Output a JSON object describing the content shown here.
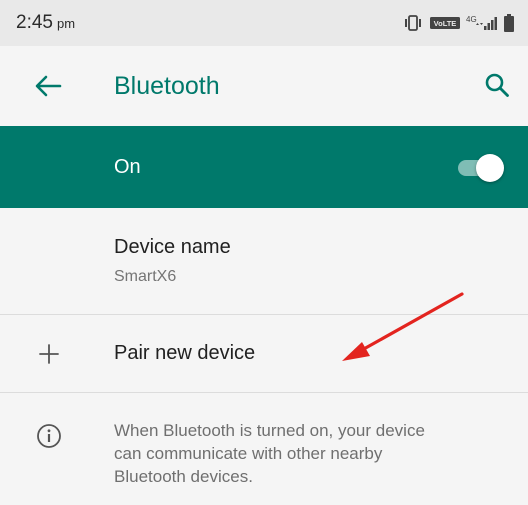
{
  "status_bar": {
    "time": "2:45",
    "ampm": "pm",
    "volte_label": "VoLTE",
    "network_label": "4G",
    "icons": [
      "vibrate-icon",
      "volte-icon",
      "signal-icon",
      "battery-icon"
    ]
  },
  "app_bar": {
    "title": "Bluetooth",
    "back_icon": "arrow-back-icon",
    "search_icon": "search-icon"
  },
  "master_switch": {
    "label": "On",
    "checked": true
  },
  "device_name_row": {
    "title": "Device name",
    "value": "SmartX6"
  },
  "pair_row": {
    "label": "Pair new device",
    "icon": "plus-icon"
  },
  "footer": {
    "line1": "When Bluetooth is turned on, your device",
    "line2": "can communicate with other nearby",
    "line3": "Bluetooth devices.",
    "icon": "info-icon"
  },
  "colors": {
    "accent": "#00796b",
    "status_bar_bg": "#e9e9e9",
    "page_bg": "#f5f5f5",
    "annotation_arrow": "#e3241f"
  }
}
